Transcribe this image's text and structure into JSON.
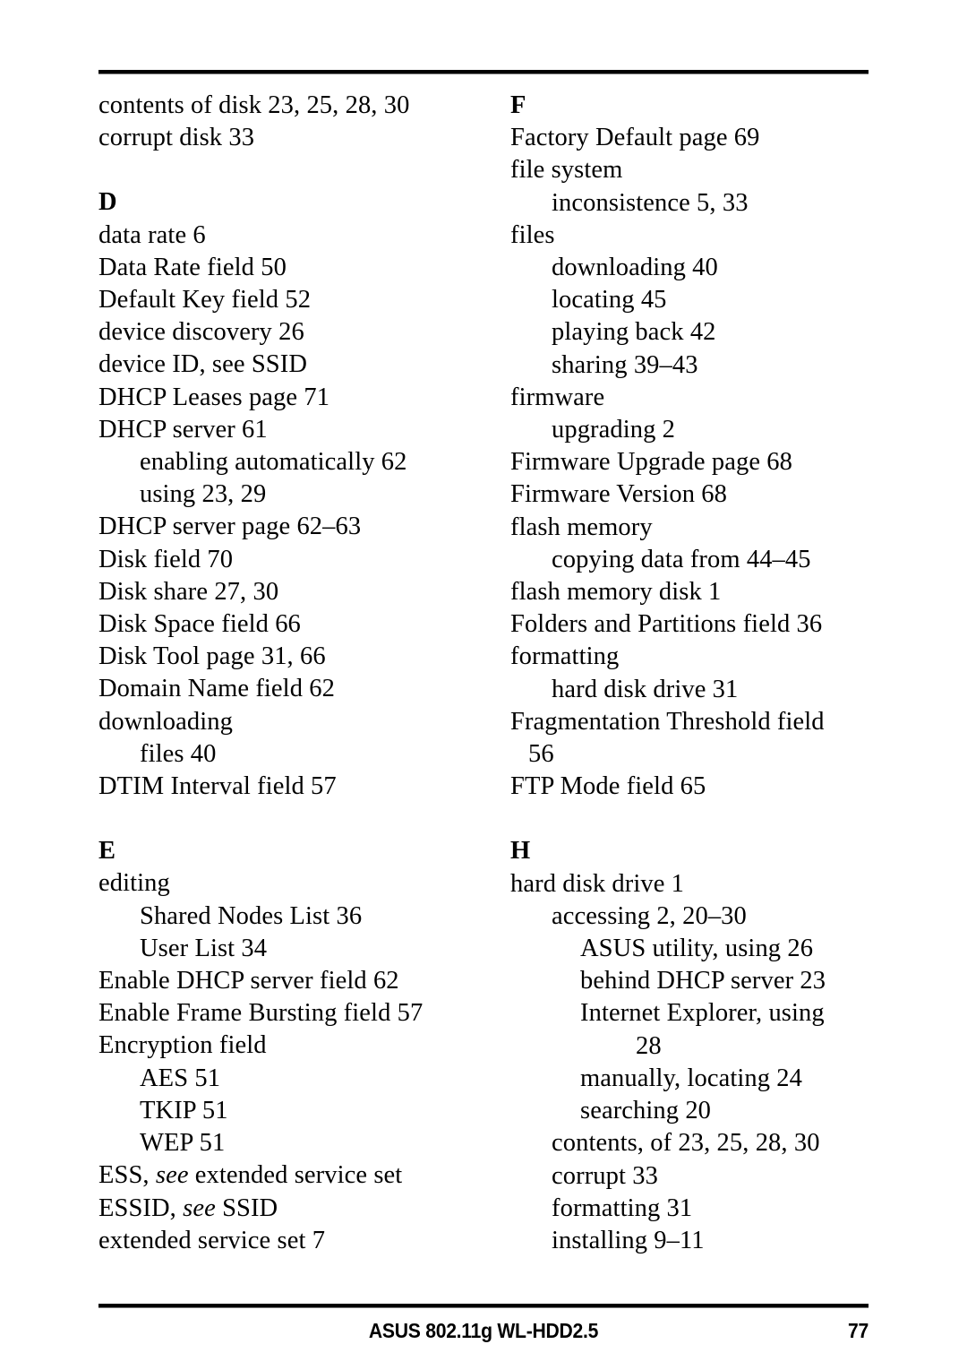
{
  "page": {
    "footer_title": "ASUS 802.11g WL-HDD2.5",
    "page_number": "77",
    "rule_color": "#000000"
  },
  "index": {
    "left_column": [
      {
        "type": "entry",
        "level": 0,
        "text": "contents of disk 23, 25, 28, 30"
      },
      {
        "type": "entry",
        "level": 0,
        "text": "corrupt disk 33"
      },
      {
        "type": "gap"
      },
      {
        "type": "heading",
        "text": "D"
      },
      {
        "type": "entry",
        "level": 0,
        "text": "data rate 6"
      },
      {
        "type": "entry",
        "level": 0,
        "text": "Data Rate field 50"
      },
      {
        "type": "entry",
        "level": 0,
        "text": "Default Key field 52"
      },
      {
        "type": "entry",
        "level": 0,
        "text": "device discovery 26"
      },
      {
        "type": "entry",
        "level": 0,
        "text": "device ID, see SSID"
      },
      {
        "type": "entry",
        "level": 0,
        "text": "DHCP Leases page 71"
      },
      {
        "type": "entry",
        "level": 0,
        "text": "DHCP server 61"
      },
      {
        "type": "entry",
        "level": 1,
        "text": "enabling automatically 62"
      },
      {
        "type": "entry",
        "level": 1,
        "text": "using 23, 29"
      },
      {
        "type": "entry",
        "level": 0,
        "text": "DHCP server page 62–63"
      },
      {
        "type": "entry",
        "level": 0,
        "text": "Disk field 70"
      },
      {
        "type": "entry",
        "level": 0,
        "text": "Disk share 27, 30"
      },
      {
        "type": "entry",
        "level": 0,
        "text": "Disk Space field 66"
      },
      {
        "type": "entry",
        "level": 0,
        "text": "Disk Tool page 31, 66"
      },
      {
        "type": "entry",
        "level": 0,
        "text": "Domain Name field 62"
      },
      {
        "type": "entry",
        "level": 0,
        "text": "downloading"
      },
      {
        "type": "entry",
        "level": 1,
        "text": "files 40"
      },
      {
        "type": "entry",
        "level": 0,
        "text": "DTIM Interval field 57"
      },
      {
        "type": "gap"
      },
      {
        "type": "heading",
        "text": "E"
      },
      {
        "type": "entry",
        "level": 0,
        "text": "editing"
      },
      {
        "type": "entry",
        "level": 1,
        "text": "Shared Nodes List 36"
      },
      {
        "type": "entry",
        "level": 1,
        "text": "User List 34"
      },
      {
        "type": "entry",
        "level": 0,
        "text": "Enable DHCP server field 62"
      },
      {
        "type": "entry",
        "level": 0,
        "text": "Enable Frame Bursting field 57"
      },
      {
        "type": "entry",
        "level": 0,
        "text": "Encryption field"
      },
      {
        "type": "entry",
        "level": 1,
        "text": "AES 51"
      },
      {
        "type": "entry",
        "level": 1,
        "text": "TKIP 51"
      },
      {
        "type": "entry",
        "level": 1,
        "text": "WEP 51"
      },
      {
        "type": "entry",
        "level": 0,
        "text": "ESS, ",
        "italic": "see",
        "text_after": " extended service set"
      },
      {
        "type": "entry",
        "level": 0,
        "text": "ESSID, ",
        "italic": "see",
        "text_after": " SSID"
      },
      {
        "type": "entry",
        "level": 0,
        "text": "extended service set 7"
      }
    ],
    "right_column": [
      {
        "type": "heading",
        "text": "F"
      },
      {
        "type": "entry",
        "level": 0,
        "text": "Factory Default page 69"
      },
      {
        "type": "entry",
        "level": 0,
        "text": "file system"
      },
      {
        "type": "entry",
        "level": 1,
        "text": "inconsistence 5, 33"
      },
      {
        "type": "entry",
        "level": 0,
        "text": "files"
      },
      {
        "type": "entry",
        "level": 1,
        "text": "downloading 40"
      },
      {
        "type": "entry",
        "level": 1,
        "text": "locating 45"
      },
      {
        "type": "entry",
        "level": 1,
        "text": "playing back 42"
      },
      {
        "type": "entry",
        "level": 1,
        "text": "sharing 39–43"
      },
      {
        "type": "entry",
        "level": 0,
        "text": "firmware"
      },
      {
        "type": "entry",
        "level": 1,
        "text": "upgrading 2"
      },
      {
        "type": "entry",
        "level": 0,
        "text": "Firmware Upgrade page 68"
      },
      {
        "type": "entry",
        "level": 0,
        "text": "Firmware Version 68"
      },
      {
        "type": "entry",
        "level": 0,
        "text": "flash memory"
      },
      {
        "type": "entry",
        "level": 1,
        "text": "copying data from 44–45"
      },
      {
        "type": "entry",
        "level": 0,
        "text": "flash memory disk 1"
      },
      {
        "type": "entry",
        "level": 0,
        "text": "Folders and Partitions field 36"
      },
      {
        "type": "entry",
        "level": 0,
        "text": "formatting"
      },
      {
        "type": "entry",
        "level": 1,
        "text": "hard disk drive 31"
      },
      {
        "type": "entry",
        "level": 0,
        "text": "Fragmentation Threshold field"
      },
      {
        "type": "entry",
        "level": "cont-small",
        "text": "56"
      },
      {
        "type": "entry",
        "level": 0,
        "text": "FTP Mode field 65"
      },
      {
        "type": "gap"
      },
      {
        "type": "heading",
        "text": "H"
      },
      {
        "type": "entry",
        "level": 0,
        "text": "hard disk drive 1"
      },
      {
        "type": "entry",
        "level": 1,
        "text": "accessing 2, 20–30"
      },
      {
        "type": "entry",
        "level": 2,
        "text": "ASUS utility, using 26"
      },
      {
        "type": "entry",
        "level": 2,
        "text": "behind DHCP server 23"
      },
      {
        "type": "entry",
        "level": 2,
        "text": "Internet Explorer, using"
      },
      {
        "type": "entry",
        "level": "cont-deep",
        "text": "28"
      },
      {
        "type": "entry",
        "level": 2,
        "text": "manually, locating 24"
      },
      {
        "type": "entry",
        "level": 2,
        "text": "searching 20"
      },
      {
        "type": "entry",
        "level": 1,
        "text": "contents, of 23, 25, 28, 30"
      },
      {
        "type": "entry",
        "level": 1,
        "text": "corrupt 33"
      },
      {
        "type": "entry",
        "level": 1,
        "text": "formatting 31"
      },
      {
        "type": "entry",
        "level": 1,
        "text": "installing 9–11"
      }
    ]
  }
}
